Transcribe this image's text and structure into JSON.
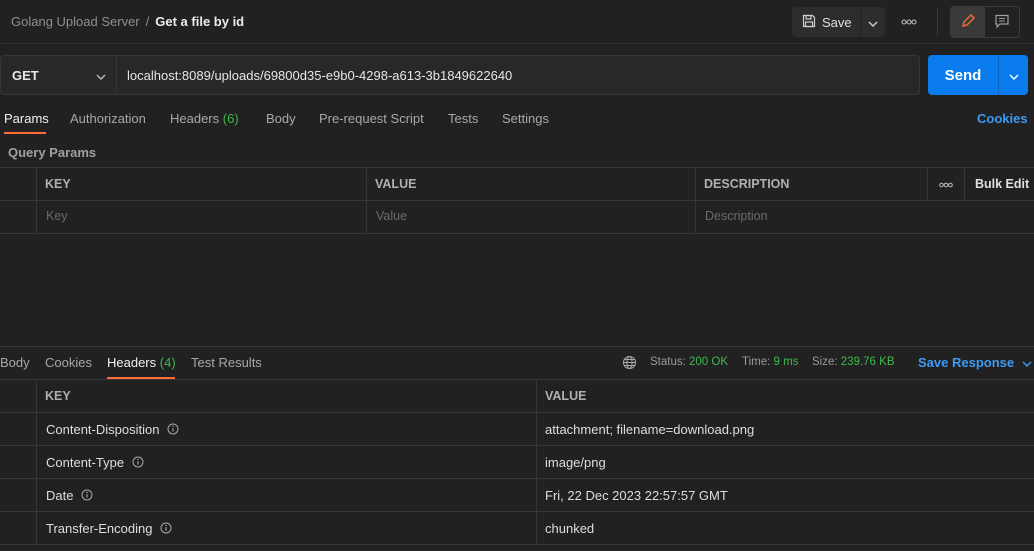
{
  "breadcrumb": {
    "collection": "Golang Upload Server",
    "separator": "/",
    "request": "Get a file by id"
  },
  "toolbar": {
    "save_label": "Save"
  },
  "request": {
    "method": "GET",
    "url": "localhost:8089/uploads/69800d35-e9b0-4298-a613-3b1849622640",
    "send_label": "Send"
  },
  "request_tabs": {
    "params": "Params",
    "authorization": "Authorization",
    "headers": "Headers",
    "headers_count": "(6)",
    "body": "Body",
    "prerequest": "Pre-request Script",
    "tests": "Tests",
    "settings": "Settings",
    "cookies": "Cookies"
  },
  "query_params": {
    "title": "Query Params",
    "columns": {
      "key": "KEY",
      "value": "VALUE",
      "description": "DESCRIPTION"
    },
    "bulk_edit": "Bulk Edit",
    "placeholders": {
      "key": "Key",
      "value": "Value",
      "description": "Description"
    }
  },
  "response_tabs": {
    "body": "Body",
    "cookies": "Cookies",
    "headers": "Headers",
    "headers_count": "(4)",
    "test_results": "Test Results"
  },
  "response_status": {
    "status_label": "Status:",
    "status_value": "200 OK",
    "time_label": "Time:",
    "time_value": "9 ms",
    "size_label": "Size:",
    "size_value": "239.76 KB",
    "save_response": "Save Response"
  },
  "response_headers": {
    "columns": {
      "key": "KEY",
      "value": "VALUE"
    },
    "rows": [
      {
        "key": "Content-Disposition",
        "value": "attachment; filename=download.png"
      },
      {
        "key": "Content-Type",
        "value": "image/png"
      },
      {
        "key": "Date",
        "value": "Fri, 22 Dec 2023 22:57:57 GMT"
      },
      {
        "key": "Transfer-Encoding",
        "value": "chunked"
      }
    ]
  },
  "colors": {
    "accent_blue": "#097bed",
    "tab_underline": "#ff6c37",
    "success_green": "#3fb950"
  }
}
